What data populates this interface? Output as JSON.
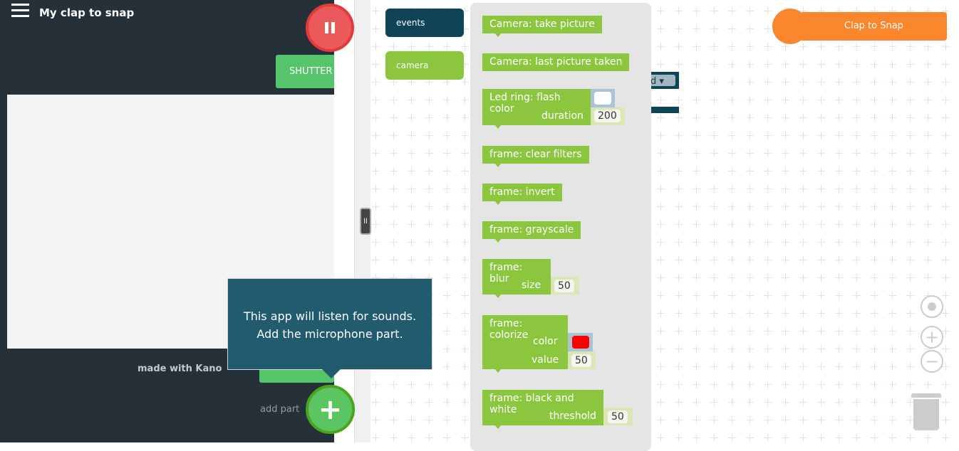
{
  "app": {
    "title": "My clap to snap",
    "menu_icon": "hamburger-icon",
    "pause_icon": "pause-icon"
  },
  "preview": {
    "shutter_label": "SHUTTER",
    "made_with": "made with Kano",
    "add_part_label": "add part",
    "add_icon": "plus-icon"
  },
  "tooltip": {
    "line1": "This app will listen for sounds.",
    "line2": "Add the microphone part."
  },
  "categories": [
    {
      "label": "events",
      "color": "#0f4457"
    },
    {
      "label": "camera",
      "color": "#8cc63f"
    }
  ],
  "blocks": {
    "take_picture": "Camera: take picture",
    "last_picture": "Camera: last picture taken",
    "led_ring": {
      "label": "Led ring: flash color",
      "duration_label": "duration",
      "duration": "200",
      "color": "#ffffff"
    },
    "clear_filters": "frame: clear filters",
    "invert": "frame: invert",
    "grayscale": "frame: grayscale",
    "blur": {
      "label": "frame: blur",
      "size_label": "size",
      "size": "50"
    },
    "colorize": {
      "label": "frame: colorize",
      "color_label": "color",
      "color": "#ff0000",
      "value_label": "value",
      "value": "50"
    },
    "bw": {
      "label": "frame: black and white",
      "threshold_label": "threshold",
      "threshold": "50"
    }
  },
  "workspace": {
    "event_block": "Clap to Snap",
    "event_color": "#f9862c",
    "hidden_dropdown": "ed ▾"
  },
  "controls": {
    "recenter": "target-icon",
    "zoom_in": "zoom-in-icon",
    "zoom_out": "zoom-out-icon",
    "trash": "trash-icon"
  },
  "colors": {
    "panel": "#263038",
    "block": "#8cc63f",
    "tooltip": "#225a6e"
  }
}
